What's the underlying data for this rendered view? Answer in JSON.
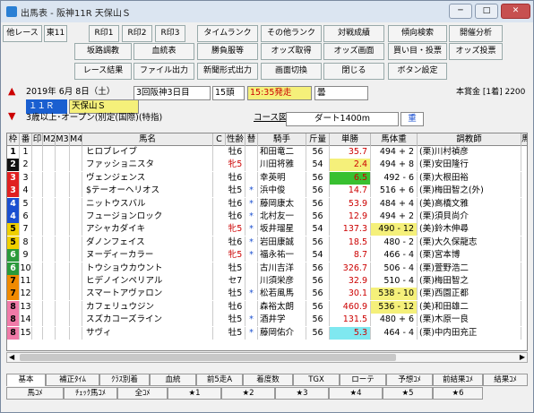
{
  "window": {
    "title": "出馬表 - 阪神11R 天保山Ｓ",
    "min": "─",
    "max": "□",
    "close": "✕"
  },
  "toolbar": {
    "row1": [
      "他レース",
      "東11",
      "R印1",
      "R印2",
      "R印3",
      "タイムランク",
      "その他ランク",
      "対戦成績",
      "傾向検索",
      "開催分析"
    ],
    "row2": [
      "坂路調教",
      "血統表",
      "勝負服等",
      "オッズ取得",
      "オッズ画面",
      "買い目・投票",
      "オッズ投票"
    ],
    "row3": [
      "レース結果",
      "ファイル出力",
      "新聞形式出力",
      "画面切換",
      "閉じる",
      "ボタン設定"
    ]
  },
  "race": {
    "date": "2019年 6月 8日（土）",
    "venue": "3回阪神3日目",
    "heads": "15頭",
    "post": "15:35発走",
    "weather": "曇",
    "num": "１１Ｒ",
    "name": "天保山Ｓ",
    "cond": "3歳以上･オープン(別定(国際)(特指)",
    "course_label": "コース図",
    "surface": "ダート1400m",
    "going": "重",
    "prize": "本賞金 [1着] 2200"
  },
  "columns": [
    "枠",
    "番",
    "印",
    "M2",
    "M3",
    "M4",
    "馬名",
    "C",
    "性齢",
    "替",
    "騎手",
    "斤量",
    "単勝",
    "馬体重",
    "調教師",
    "馬記"
  ],
  "runners": [
    {
      "w": "1",
      "n": "1",
      "name": "ヒロブレイブ",
      "sex": "牡6",
      "ch": "",
      "jk": "和田竜二",
      "kg": "56",
      "odds": "35.7",
      "wt": "494 + 2",
      "tr": "(栗)川村禎彦"
    },
    {
      "w": "2",
      "n": "2",
      "name": "ファッショニスタ",
      "sex": "牝5",
      "ch": "",
      "jk": "川田将雅",
      "kg": "54",
      "odds": "2.4",
      "wt": "494 + 8",
      "tr": "(栗)安田隆行"
    },
    {
      "w": "3",
      "n": "3",
      "name": "ヴェンジェンス",
      "sex": "牡6",
      "ch": "",
      "jk": "幸英明",
      "kg": "56",
      "odds": "6.5",
      "wt": "492 - 6",
      "tr": "(栗)大根田裕"
    },
    {
      "w": "3",
      "n": "4",
      "name": "$テーオーヘリオス",
      "sex": "牡5",
      "ch": "*",
      "jk": "浜中俊",
      "kg": "56",
      "odds": "14.7",
      "wt": "516 + 6",
      "tr": "(栗)梅田智之(外)"
    },
    {
      "w": "4",
      "n": "5",
      "name": "ニットウスバル",
      "sex": "牡6",
      "ch": "*",
      "jk": "藤岡康太",
      "kg": "56",
      "odds": "53.9",
      "wt": "484 + 4",
      "tr": "(美)高橋文雅"
    },
    {
      "w": "4",
      "n": "6",
      "name": "フュージョンロック",
      "sex": "牡6",
      "ch": "*",
      "jk": "北村友一",
      "kg": "56",
      "odds": "12.9",
      "wt": "494 + 2",
      "tr": "(栗)須貝尚介"
    },
    {
      "w": "5",
      "n": "7",
      "name": "アシャカダイキ",
      "sex": "牝5",
      "ch": "*",
      "jk": "坂井瑠星",
      "kg": "54",
      "odds": "137.3",
      "wt": "490 - 12",
      "tr": "(美)鈴木伸尋"
    },
    {
      "w": "5",
      "n": "8",
      "name": "ダノンフェイス",
      "sex": "牡6",
      "ch": "*",
      "jk": "岩田康誠",
      "kg": "56",
      "odds": "18.5",
      "wt": "480 - 2",
      "tr": "(栗)大久保龍志"
    },
    {
      "w": "6",
      "n": "9",
      "name": "ヌーディーカラー",
      "sex": "牝5",
      "ch": "*",
      "jk": "福永祐一",
      "kg": "54",
      "odds": "8.7",
      "wt": "466 - 4",
      "tr": "(栗)宮本博"
    },
    {
      "w": "6",
      "n": "10",
      "name": "トウショウカウント",
      "sex": "牡5",
      "ch": "",
      "jk": "古川吉洋",
      "kg": "56",
      "odds": "326.7",
      "wt": "506 - 4",
      "tr": "(栗)萱野浩二"
    },
    {
      "w": "7",
      "n": "11",
      "name": "ヒデノインペリアル",
      "sex": "セ7",
      "ch": "",
      "jk": "川須栄彦",
      "kg": "56",
      "odds": "32.9",
      "wt": "510 - 4",
      "tr": "(栗)梅田智之"
    },
    {
      "w": "7",
      "n": "12",
      "name": "スマートアヴァロン",
      "sex": "牡5",
      "ch": "*",
      "jk": "松若風馬",
      "kg": "56",
      "odds": "30.1",
      "wt": "538 - 10",
      "tr": "(栗)西園正都"
    },
    {
      "w": "8",
      "n": "13",
      "name": "カフェリュウジン",
      "sex": "牡6",
      "ch": "",
      "jk": "森裕太朗",
      "kg": "56",
      "odds": "460.9",
      "wt": "536 - 12",
      "tr": "(美)和田雄二"
    },
    {
      "w": "8",
      "n": "14",
      "name": "スズカコーズライン",
      "sex": "牡5",
      "ch": "*",
      "jk": "酒井学",
      "kg": "56",
      "odds": "131.5",
      "wt": "480 + 6",
      "tr": "(栗)木原一良"
    },
    {
      "w": "8",
      "n": "15",
      "name": "サヴィ",
      "sex": "牡5",
      "ch": "*",
      "jk": "藤岡佑介",
      "kg": "56",
      "odds": "5.3",
      "wt": "464 - 4",
      "tr": "(栗)中内田充正"
    }
  ],
  "tabs1": [
    "基本",
    "補正ﾀｲﾑ",
    "ｸﾗｽ別着",
    "血統",
    "前5走A",
    "着度数",
    "TGX",
    "ローテ",
    "予想ｺﾒ",
    "前結果ｺﾒ",
    "結果ｺﾒ"
  ],
  "tabs2": [
    "馬ｺﾒ",
    "ﾁｪｯｸ馬ｺﾒ",
    "全ｺﾒ",
    "★1",
    "★2",
    "★3",
    "★4",
    "★5",
    "★6"
  ],
  "colors": {
    "w1": "#ffffff",
    "w2": "#111111",
    "w3": "#e02020",
    "w4": "#1a4fd0",
    "w5": "#f0d000",
    "w6": "#2a9a3a",
    "w7": "#f08a00",
    "w8": "#f07aa8",
    "odds_fav": "#f5f07a",
    "odds_1": "#38c030",
    "odds_2": "#7fe8f0",
    "wt_hl": "#f5f07a"
  }
}
